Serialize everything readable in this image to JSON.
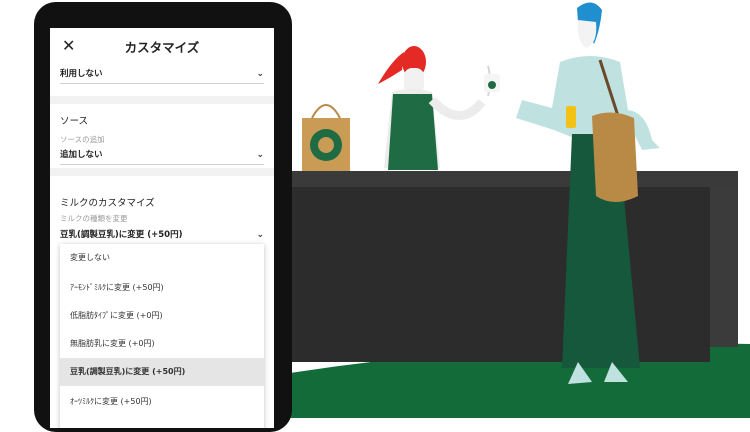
{
  "header": {
    "close_symbol": "✕",
    "title": "カスタマイズ"
  },
  "top_select": {
    "value": "利用しない"
  },
  "sauce": {
    "title": "ソース",
    "sublabel": "ソースの追加",
    "value": "追加しない"
  },
  "milk": {
    "title": "ミルクのカスタマイズ",
    "sublabel": "ミルクの種類を変更",
    "value": "豆乳(調製豆乳)に変更 (+50円)"
  },
  "dropdown": {
    "options": [
      {
        "label": "変更しない"
      },
      {
        "label": "ｱｰﾓﾝﾄﾞﾐﾙｸに変更 (+50円)"
      },
      {
        "label": "低脂肪ﾀｲﾌﾟに変更 (+0円)"
      },
      {
        "label": "無脂肪乳に変更 (+0円)"
      },
      {
        "label": "豆乳(調製豆乳)に変更 (+50円)"
      },
      {
        "label": "ｵｰﾂﾐﾙｸに変更 (+50円)"
      }
    ],
    "selected_index": 4
  },
  "chevron_symbol": "⌄",
  "colors": {
    "starbucks_green": "#1e6b44",
    "floor_green": "#136b3a",
    "counter": "#2e2e2e",
    "hair_red": "#e32a24",
    "hair_blue": "#1f8fd0",
    "bag": "#c99b55"
  }
}
